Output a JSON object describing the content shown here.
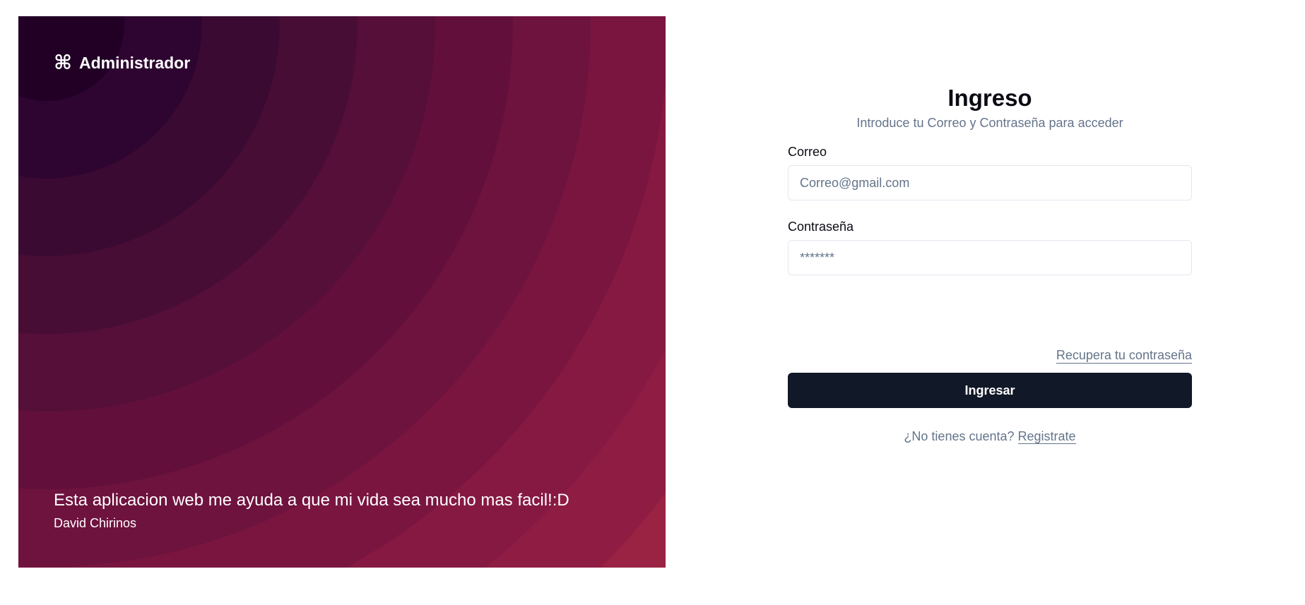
{
  "brand": {
    "icon": "command-icon",
    "glyph": "⌘",
    "name": "Administrador"
  },
  "testimonial": {
    "quote": "Esta aplicacion web me ayuda a que mi vida sea mucho mas facil!:D",
    "author": "David Chirinos"
  },
  "login": {
    "title": "Ingreso",
    "subtitle": "Introduce tu Correo y Contraseña para acceder",
    "email": {
      "label": "Correo",
      "placeholder": "Correo@gmail.com",
      "value": ""
    },
    "password": {
      "label": "Contraseña",
      "placeholder": "*******",
      "value": ""
    },
    "recover_link": "Recupera tu contraseña",
    "submit_label": "Ingresar",
    "signup_prompt": "¿No tienes cuenta?",
    "signup_link": "Registrate"
  },
  "colors": {
    "button": "#111827",
    "muted": "#64748b",
    "panel_dark": "#220026",
    "panel_light": "#bc3c3c"
  }
}
